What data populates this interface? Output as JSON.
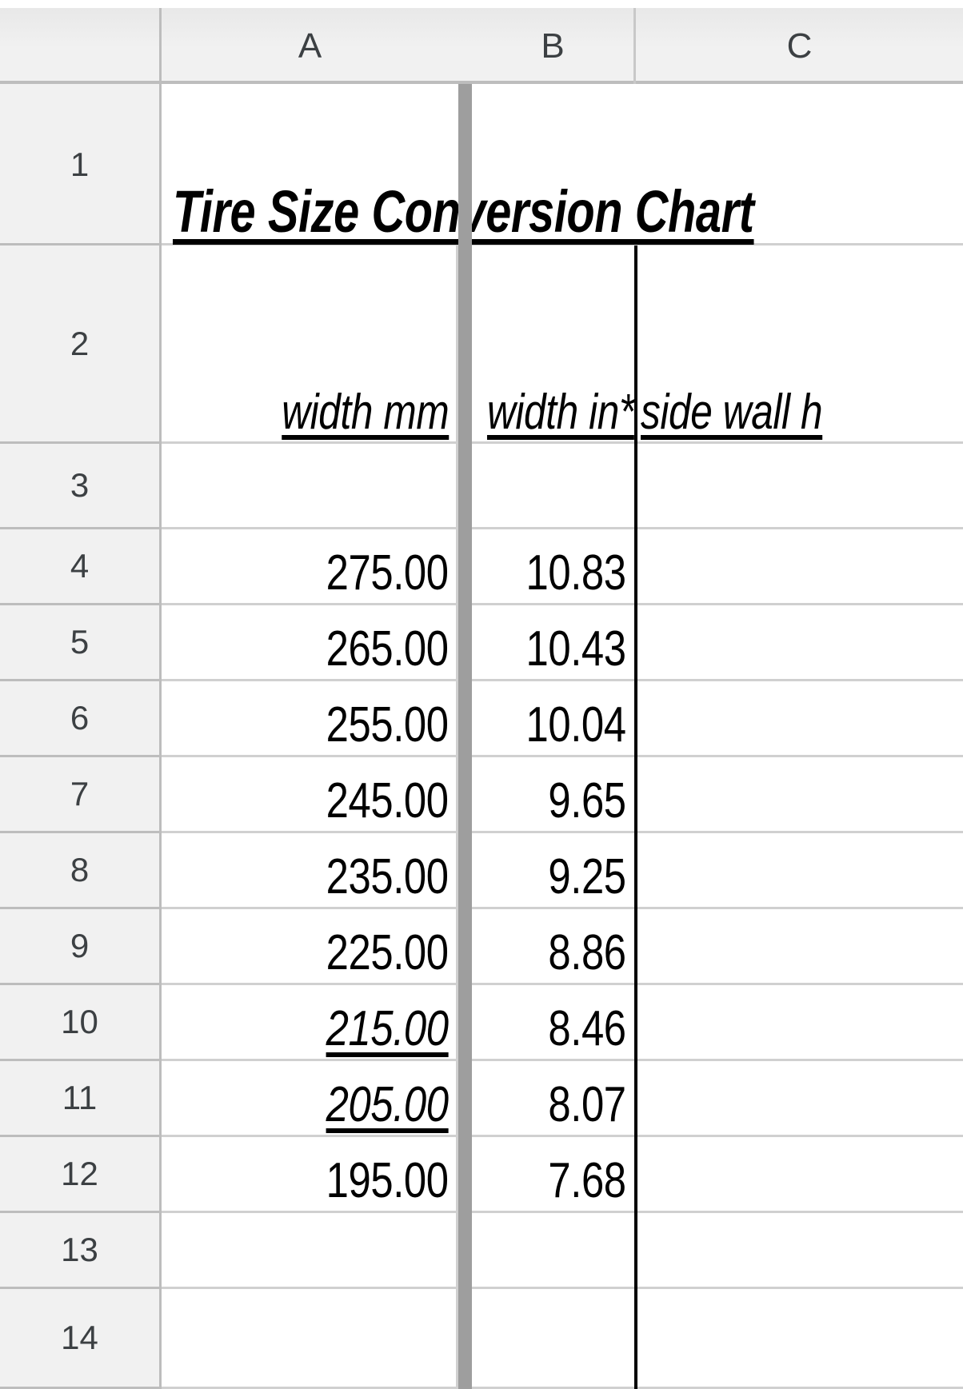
{
  "app": {
    "type": "spreadsheet"
  },
  "column_headers": [
    {
      "key": "corner",
      "label": ""
    },
    {
      "key": "A",
      "label": "A"
    },
    {
      "key": "B",
      "label": "B"
    },
    {
      "key": "C",
      "label": "C"
    }
  ],
  "row_headers": [
    "1",
    "2",
    "3",
    "4",
    "5",
    "6",
    "7",
    "8",
    "9",
    "10",
    "11",
    "12",
    "13",
    "14"
  ],
  "title": {
    "text": "Tire Size Conversion Chart",
    "style": "bold-italic-underline"
  },
  "table_headers": {
    "a": "width mm",
    "b": "width in*",
    "c": "side wall h"
  },
  "rows": [
    {
      "row": "3",
      "a": "",
      "b": "",
      "c": "",
      "a_style": "normal"
    },
    {
      "row": "4",
      "a": "275.00",
      "b": "10.83",
      "c": "",
      "a_style": "normal"
    },
    {
      "row": "5",
      "a": "265.00",
      "b": "10.43",
      "c": "",
      "a_style": "normal"
    },
    {
      "row": "6",
      "a": "255.00",
      "b": "10.04",
      "c": "",
      "a_style": "normal"
    },
    {
      "row": "7",
      "a": "245.00",
      "b": "9.65",
      "c": "",
      "a_style": "normal"
    },
    {
      "row": "8",
      "a": "235.00",
      "b": "9.25",
      "c": "",
      "a_style": "normal"
    },
    {
      "row": "9",
      "a": "225.00",
      "b": "8.86",
      "c": "",
      "a_style": "normal"
    },
    {
      "row": "10",
      "a": "215.00",
      "b": "8.46",
      "c": "",
      "a_style": "italic-underline"
    },
    {
      "row": "11",
      "a": "205.00",
      "b": "8.07",
      "c": "",
      "a_style": "italic-underline"
    },
    {
      "row": "12",
      "a": "195.00",
      "b": "7.68",
      "c": "",
      "a_style": "normal"
    },
    {
      "row": "13",
      "a": "",
      "b": "",
      "c": "",
      "a_style": "normal"
    },
    {
      "row": "14",
      "a": "",
      "b": "",
      "c": "",
      "a_style": "normal"
    }
  ],
  "colors": {
    "header_bg": "#f1f1f1",
    "grid_line": "#d0d0d0",
    "header_line": "#bdbdbd",
    "freeze_divider": "#9e9e9e",
    "cell_border_black": "#000000",
    "text": "#000000",
    "header_text": "#3c4043",
    "sheet_bg": "#ffffff"
  }
}
